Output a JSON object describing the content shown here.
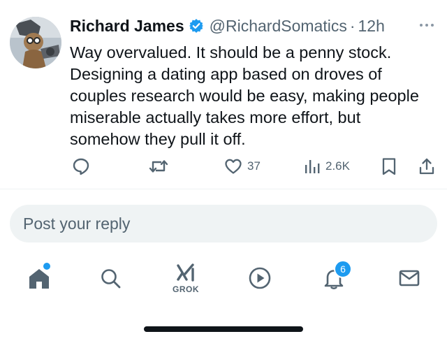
{
  "tweet": {
    "author_name": "Richard James",
    "handle": "@RichardSomatics",
    "separator": "·",
    "time": "12h",
    "body_lines": [
      "Way overvalued. It should be a penny stock.",
      "Designing a dating app based on droves of",
      "couples research would be easy, making people",
      "miserable actually takes more effort, but",
      "somehow they pull it off."
    ],
    "likes": "37",
    "views": "2.6K"
  },
  "reply": {
    "placeholder": "Post your reply"
  },
  "tabbar": {
    "grok_label": "GROK",
    "notifications_count": "6"
  },
  "colors": {
    "accent": "#1d9bf0",
    "icon_gray": "#536471",
    "text": "#0f1419"
  }
}
